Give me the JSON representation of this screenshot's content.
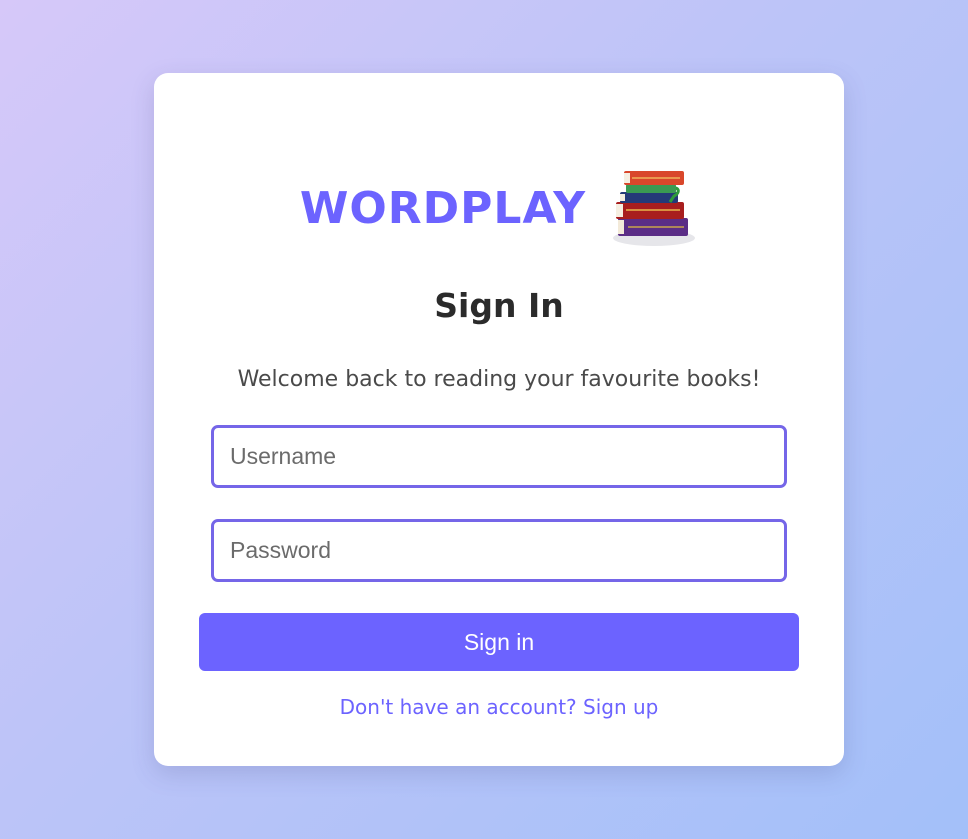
{
  "brand": {
    "name": "WORDPLAY",
    "icon": "books-stack-icon"
  },
  "form": {
    "title": "Sign In",
    "subtitle": "Welcome back to reading your favourite books!",
    "username_placeholder": "Username",
    "password_placeholder": "Password",
    "submit_label": "Sign in",
    "signup_text": "Don't have an account? Sign up"
  },
  "colors": {
    "accent": "#6c63ff",
    "input_border": "#7566e8",
    "title": "#2b2b2b",
    "card": "#ffffff"
  }
}
